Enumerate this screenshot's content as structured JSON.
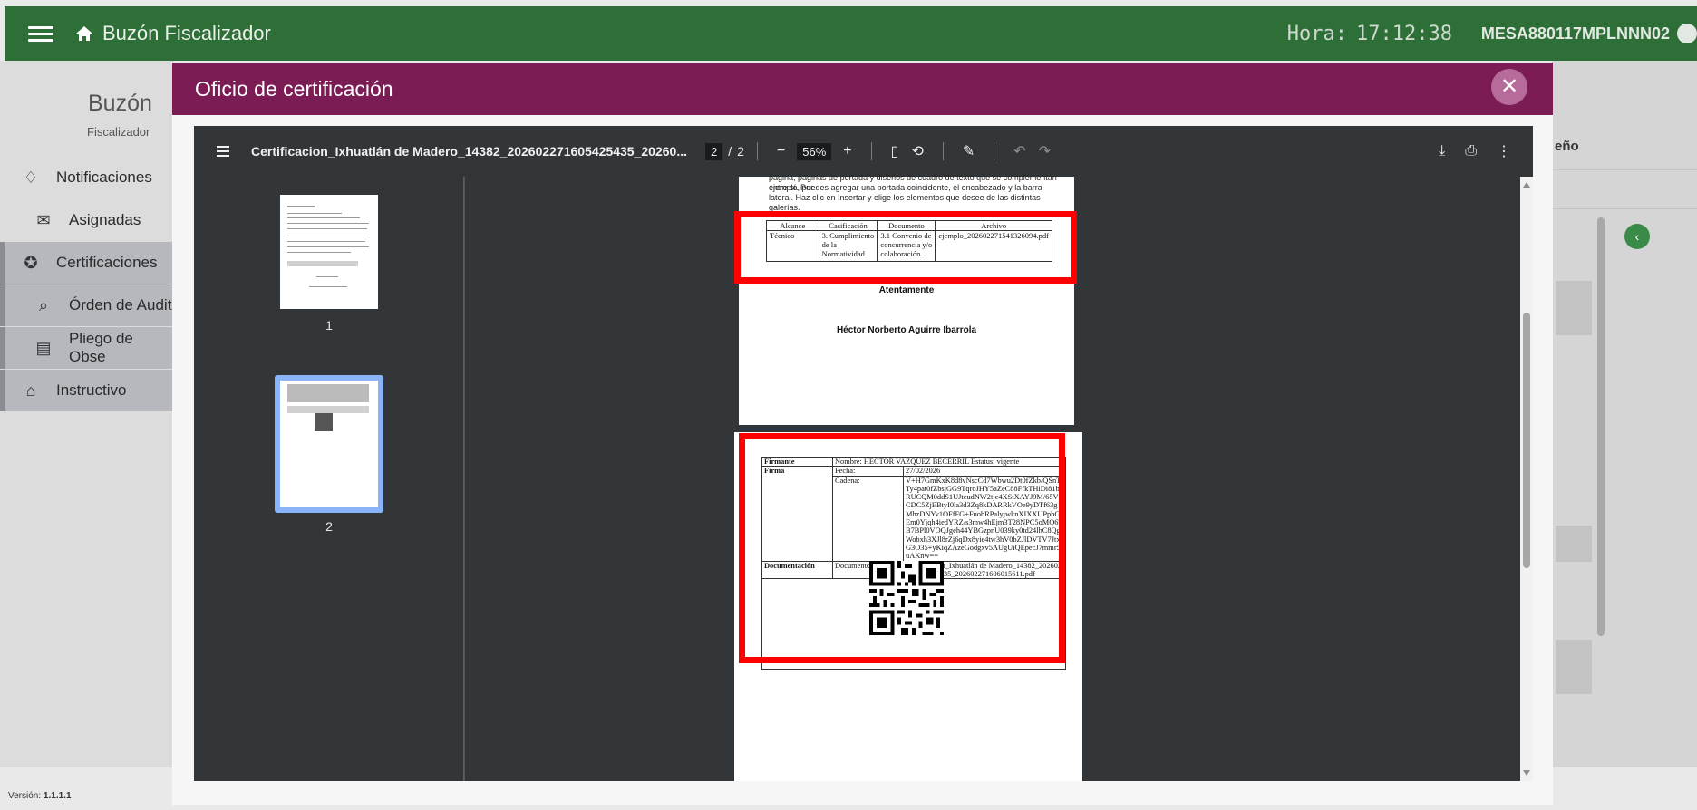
{
  "app": {
    "title": "Buzón Fiscalizador",
    "clock_label": "Hora:",
    "clock_value": "17:12:38",
    "user": "MESA880117MPLNNN02"
  },
  "sidebar": {
    "title": "Buzón",
    "subtitle": "Fiscalizador",
    "items": [
      {
        "label": "Notificaciones"
      },
      {
        "label": "Asignadas"
      },
      {
        "label": "Certificaciones"
      },
      {
        "label": "Órden de Audit"
      },
      {
        "label": "Pliego de Obse"
      },
      {
        "label": "Instructivo"
      }
    ],
    "version_label": "Versión:",
    "version_value": "1.1.1.1"
  },
  "background": {
    "column_fragment": "eño"
  },
  "modal": {
    "title": "Oficio de certificación",
    "close_icon": "close-icon"
  },
  "viewer": {
    "file_name": "Certificacion_Ixhuatlán de Madero_14382_202602271605425435_20260...",
    "current_page": "2",
    "page_sep": "/",
    "total_pages": "2",
    "zoom": "56%",
    "thumb_labels": [
      "1",
      "2"
    ]
  },
  "document": {
    "intro_text": "ejemplo, puedes agregar una portada coincidente, el encabezado y la barra lateral. Haz clic en Insertar y elige los elementos que desee de las distintas galerías.",
    "intro_top": "página, páginas de portada y diseños de cuadro de texto que se complementan entre sí. Por",
    "table_headers": [
      "Alcance",
      "Casificación",
      "Documento",
      "Archivo"
    ],
    "table_row": [
      "Técnico",
      "3. Cumplimiento de la Normatividad",
      "3.1 Convenio de concurrencia y/o colaboración.",
      "ejemplo_202602271541326094.pdf"
    ],
    "closing": "Atentamente",
    "signer": "Héctor Norberto Aguirre Ibarrola",
    "signature": {
      "firmante_label": "Firmante",
      "nombre": "Nombre: HECTOR VAZQUEZ BECERRIL",
      "estatus": "Estatus: vigente",
      "firma_label": "Firma",
      "fecha_label": "Fecha:",
      "fecha_value": "27/02/2026",
      "cadena_label": "Cadena:",
      "cadena_value": "V+H7GmKxK8d8vNscCd7Wbwu2Dt0fZkb/QSnTTy4pat0fZbsjGG9TqroJHY5aZeC88FfkTHiDi81bRUCQM0ddS1UJtcudNW2tjc4XStXAYJ9M/65VCDC5ZjEBtyI0la3d3Zq8kDARRkVOe9yDTf63gMhzDNYv1OFfFG+FuobRPalyjwknXIXXUPpbGEm0Yjqh4iedYRZ/s3mw4hEjm3T28NPC5oMO6TB7BPl0VOQJgeh44YBGzpnU039ky0td24lhC8QgWobxh3XJl8rZj6qDx8yie4tw3hV0bZJlDVTV7JtxG3O35+yKiqZAzeGodgxv5AUgUiQEpecJ7mmr5uAKnw==",
      "doc_label": "Documentación",
      "doc_key": "Documento firmado:",
      "doc_value": "Certificacion_Ixhuatlán de Madero_14382_202602271605425435_202602271606015611.pdf"
    }
  },
  "colors": {
    "topbar": "#2e6e37",
    "modal_header": "#7b1c55",
    "highlight": "#ff0000",
    "thumb_selected": "#8ab4f8"
  }
}
